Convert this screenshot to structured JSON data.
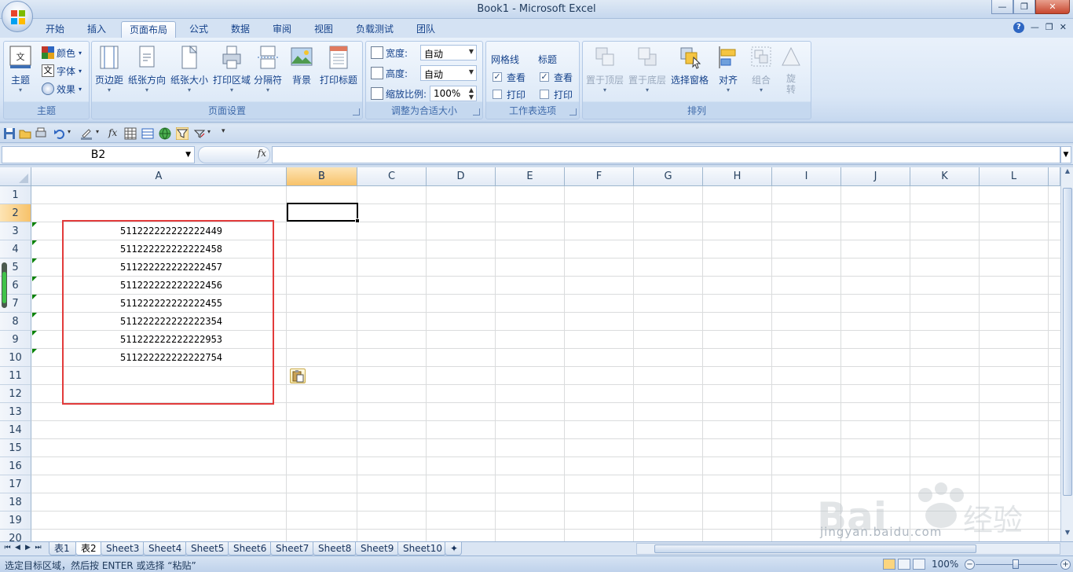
{
  "window": {
    "title": "Book1 - Microsoft Excel",
    "controls": [
      "—",
      "❐",
      "✕"
    ]
  },
  "ribbon_tabs": [
    {
      "label": "开始",
      "active": false
    },
    {
      "label": "插入",
      "active": false
    },
    {
      "label": "页面布局",
      "active": true
    },
    {
      "label": "公式",
      "active": false
    },
    {
      "label": "数据",
      "active": false
    },
    {
      "label": "审阅",
      "active": false
    },
    {
      "label": "视图",
      "active": false
    },
    {
      "label": "负载测试",
      "active": false
    },
    {
      "label": "团队",
      "active": false
    }
  ],
  "ribbon": {
    "themes": {
      "label": "主题",
      "theme_button": "主题",
      "colors": "颜色",
      "fonts": "字体",
      "effects": "效果"
    },
    "page_setup": {
      "label": "页面设置",
      "buttons": [
        "页边距",
        "纸张方向",
        "纸张大小",
        "打印区域",
        "分隔符",
        "背景",
        "打印标题"
      ]
    },
    "scale_to_fit": {
      "label": "调整为合适大小",
      "width_label": "宽度:",
      "width_value": "自动",
      "height_label": "高度:",
      "height_value": "自动",
      "scale_label": "缩放比例:",
      "scale_value": "100%"
    },
    "sheet_options": {
      "label": "工作表选项",
      "gridlines_header": "网格线",
      "headings_header": "标题",
      "view": "查看",
      "print": "打印",
      "gridlines_view_checked": true,
      "headings_view_checked": true
    },
    "arrange": {
      "label": "排列",
      "buttons": [
        "置于顶层",
        "置于底层",
        "选择窗格",
        "对齐",
        "组合",
        "旋转"
      ]
    }
  },
  "formula_bar": {
    "name_box": "B2",
    "fx": "fx",
    "formula": ""
  },
  "grid": {
    "columns": [
      "A",
      "B",
      "C",
      "D",
      "E",
      "F",
      "G",
      "H",
      "I",
      "J",
      "K",
      "L"
    ],
    "selected_column": "B",
    "rows": [
      "1",
      "2",
      "3",
      "4",
      "5",
      "6",
      "7",
      "8",
      "9",
      "10",
      "11",
      "12",
      "13",
      "14",
      "15",
      "16",
      "17",
      "18",
      "19",
      "20"
    ],
    "selected_row": "2",
    "cells_A": [
      "511222222222222449",
      "511222222222222458",
      "511222222222222457",
      "511222222222222456",
      "511222222222222455",
      "511222222222222354",
      "511222222222222953",
      "511222222222222754"
    ]
  },
  "sheets": [
    "表1",
    "表2",
    "Sheet3",
    "Sheet4",
    "Sheet5",
    "Sheet6",
    "Sheet7",
    "Sheet8",
    "Sheet9",
    "Sheet10"
  ],
  "active_sheet": "表2",
  "status": {
    "message": "选定目标区域，然后按 ENTER 或选择 “粘贴”",
    "zoom": "100%"
  },
  "watermark": {
    "brand": "Bai du 经验",
    "url": "jingyan.baidu.com"
  }
}
